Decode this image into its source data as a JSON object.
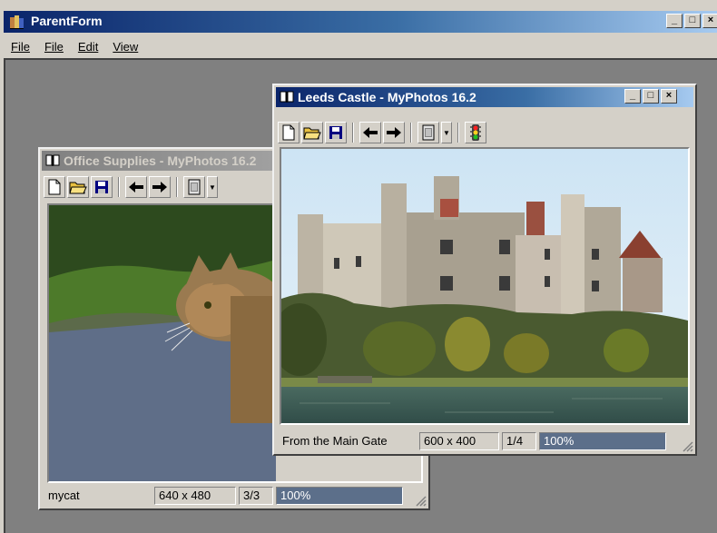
{
  "parent": {
    "title": "ParentForm",
    "caption_buttons": {
      "minimize": "_",
      "maximize": "□",
      "close": "×"
    },
    "menu": [
      "File",
      "File",
      "Edit",
      "View"
    ]
  },
  "office_window": {
    "title": "Office Supplies - MyPhotos 16.2",
    "status": {
      "caption": "mycat",
      "size": "640 x 480",
      "index": "3/3",
      "progress": "100%",
      "progress_value": 1.0
    }
  },
  "leeds_window": {
    "title": "Leeds Castle - MyPhotos 16.2",
    "caption_buttons": {
      "minimize": "_",
      "maximize": "□",
      "close": "×"
    },
    "status": {
      "caption": "From the Main Gate",
      "size": "600 x 400",
      "index": "1/4",
      "progress": "100%",
      "progress_value": 1.0
    }
  },
  "colors": {
    "active_title": "#0a246a",
    "inactive_title": "#808080",
    "mdi_background": "#808080",
    "progress": "#5c6f8a"
  }
}
